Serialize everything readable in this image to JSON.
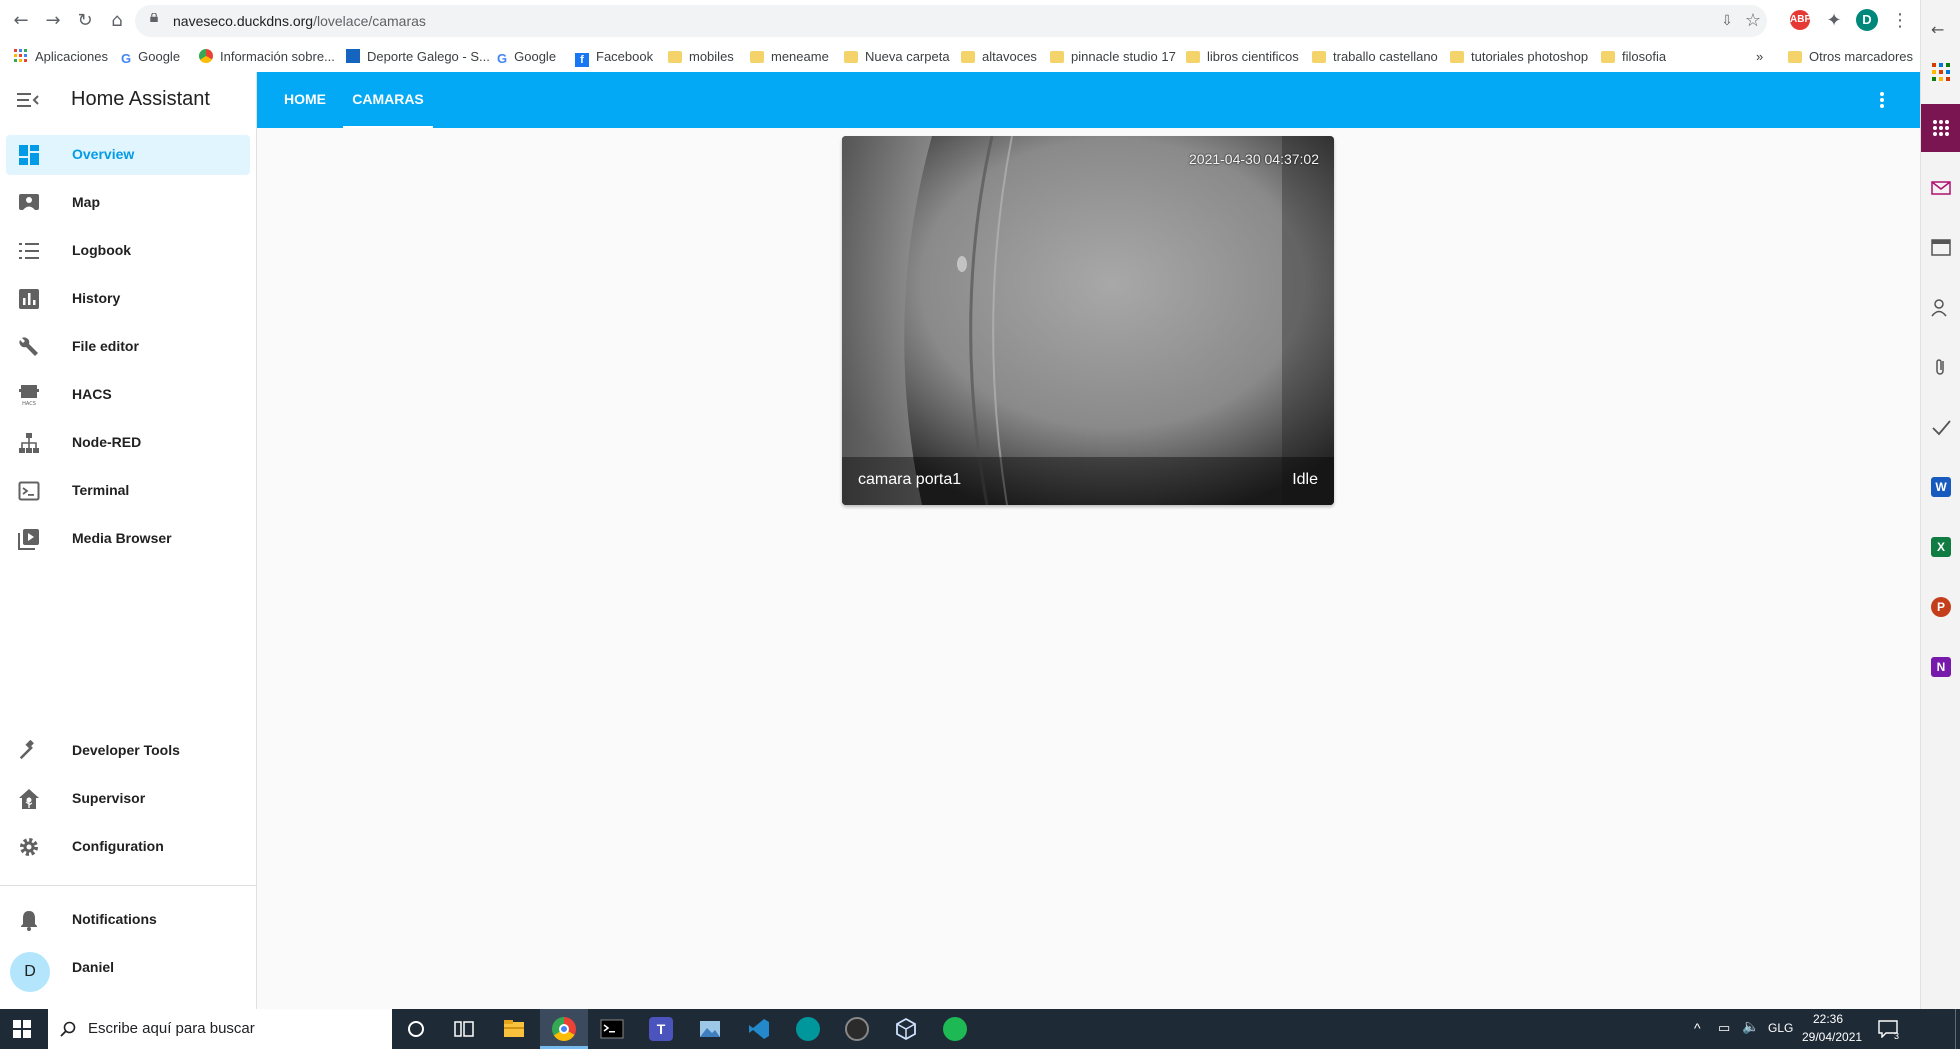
{
  "browser": {
    "url_host": "naveseco.duckdns.org",
    "url_path": "/lovelace/camaras",
    "profile_initial": "D",
    "ext_abp": "ABP"
  },
  "bookmarks": [
    {
      "label": "Aplicaciones",
      "icon": "apps-grid-icon"
    },
    {
      "label": "Google",
      "icon": "google-icon"
    },
    {
      "label": "Información sobre...",
      "icon": "chrome-icon"
    },
    {
      "label": "Deporte Galego - S...",
      "icon": "building-icon"
    },
    {
      "label": "Google",
      "icon": "google-icon"
    },
    {
      "label": "Facebook",
      "icon": "facebook-icon"
    },
    {
      "label": "mobiles",
      "icon": "folder-icon"
    },
    {
      "label": "meneame",
      "icon": "folder-icon"
    },
    {
      "label": "Nueva carpeta",
      "icon": "folder-icon"
    },
    {
      "label": "altavoces",
      "icon": "folder-icon"
    },
    {
      "label": "pinnacle studio 17",
      "icon": "folder-icon"
    },
    {
      "label": "libros cientificos",
      "icon": "folder-icon"
    },
    {
      "label": "traballo castellano",
      "icon": "folder-icon"
    },
    {
      "label": "tutoriales photoshop",
      "icon": "folder-icon"
    },
    {
      "label": "filosofia",
      "icon": "folder-icon"
    },
    {
      "label": "Otros marcadores",
      "icon": "folder-icon"
    }
  ],
  "bookmarks_overflow": "»",
  "sidebar": {
    "title": "Home Assistant",
    "items": [
      {
        "label": "Overview",
        "icon": "dashboard-icon",
        "active": true
      },
      {
        "label": "Map",
        "icon": "map-icon"
      },
      {
        "label": "Logbook",
        "icon": "logbook-icon"
      },
      {
        "label": "History",
        "icon": "history-chart-icon"
      },
      {
        "label": "File editor",
        "icon": "wrench-icon"
      },
      {
        "label": "HACS",
        "icon": "hacs-icon"
      },
      {
        "label": "Node-RED",
        "icon": "sitemap-icon"
      },
      {
        "label": "Terminal",
        "icon": "terminal-icon"
      },
      {
        "label": "Media Browser",
        "icon": "play-box-icon"
      }
    ],
    "bottom_items": [
      {
        "label": "Developer Tools",
        "icon": "hammer-icon"
      },
      {
        "label": "Supervisor",
        "icon": "home-assistant-icon"
      },
      {
        "label": "Configuration",
        "icon": "cog-icon"
      }
    ],
    "notifications_label": "Notifications",
    "user": {
      "name": "Daniel",
      "initial": "D"
    }
  },
  "tabs": [
    {
      "label": "HOME",
      "active": false
    },
    {
      "label": "CAMARAS",
      "active": true
    }
  ],
  "camera": {
    "timestamp": "2021-04-30 04:37:02",
    "name": "camara porta1",
    "state": "Idle"
  },
  "taskbar": {
    "search_placeholder": "Escribe aquí para buscar",
    "language": "GLG",
    "time": "22:36",
    "date": "29/04/2021",
    "notification_count": "3"
  },
  "colors": {
    "accent": "#03a9f4",
    "active_nav_bg": "#e1f5fe",
    "active_nav_text": "#039be5"
  }
}
